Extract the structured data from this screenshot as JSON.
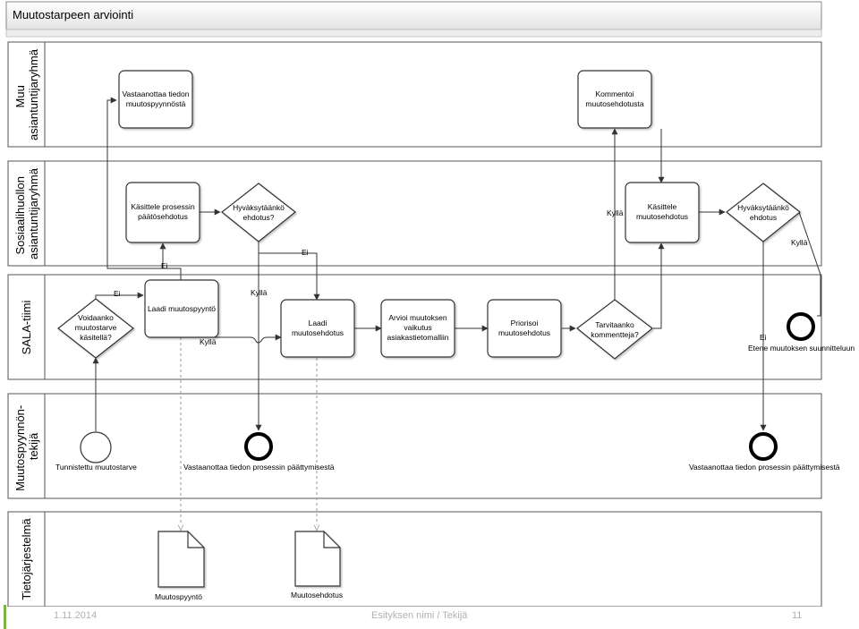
{
  "title": "Muutostarpeen arviointi",
  "lanes": [
    {
      "id": "muu",
      "label": [
        "Muu",
        "asiantuntijaryhmä"
      ]
    },
    {
      "id": "sosiaali",
      "label": [
        "Sosiaalihuollon",
        "asiantuntijaryhmä"
      ]
    },
    {
      "id": "sala",
      "label": [
        "SALA-tiimi"
      ]
    },
    {
      "id": "tekija",
      "label": [
        "Muutospyynnön-",
        "tekijä"
      ]
    },
    {
      "id": "tieto",
      "label": [
        "Tietojärjestelmä"
      ]
    }
  ],
  "tasks": {
    "vastaanottaa": [
      "Vastaanottaa tiedon",
      "muutospyynnöstä"
    ],
    "kommentoi": [
      "Kommentoi",
      "muutosehdotusta"
    ],
    "kasittele_prosessin": [
      "Käsittele prosessin",
      "päätösehdotus"
    ],
    "kasittele": [
      "Käsittele",
      "muutosehdotus"
    ],
    "laadi_muutospyynto": [
      "Laadi muutospyyntö"
    ],
    "laadi_muutosehdotus": [
      "Laadi",
      "muutosehdotus"
    ],
    "arvioi": [
      "Arvioi muutoksen",
      "vaikutus",
      "asiakastietomalliin"
    ],
    "priorisoi": [
      "Priorisoi",
      "muutosehdotus"
    ]
  },
  "gateways": {
    "hyvaksytaanko1": [
      "Hyväksytäänkö",
      "ehdotus?"
    ],
    "hyvaksytaanko2": [
      "Hyväksytäänkö",
      "ehdotus"
    ],
    "voidaanko": [
      "Voidaanko",
      "muutostarve",
      "käsitellä?"
    ],
    "tarvitaanko": [
      "Tarvitaanko",
      "kommentteja?"
    ]
  },
  "events": {
    "start": "Tunnistettu muutostarve",
    "end1": "Vastaanottaa tiedon prosessin päättymisestä",
    "end2": "Vastaanottaa tiedon prosessin päättymisestä",
    "sala_end": "Etene muutoksen suunnitteluun"
  },
  "edge_labels": {
    "yes": "Kyllä",
    "no": "Ei"
  },
  "documents": {
    "doc1": "Muutospyyntö",
    "doc2": "Muutosehdotus"
  },
  "footer": {
    "left": "1.11.2014",
    "center": "Esityksen nimi / Tekijä",
    "right": "11"
  },
  "colors": {
    "line": "#333333",
    "association": "#9a9a9a",
    "footer_accent": "#7cb342"
  }
}
